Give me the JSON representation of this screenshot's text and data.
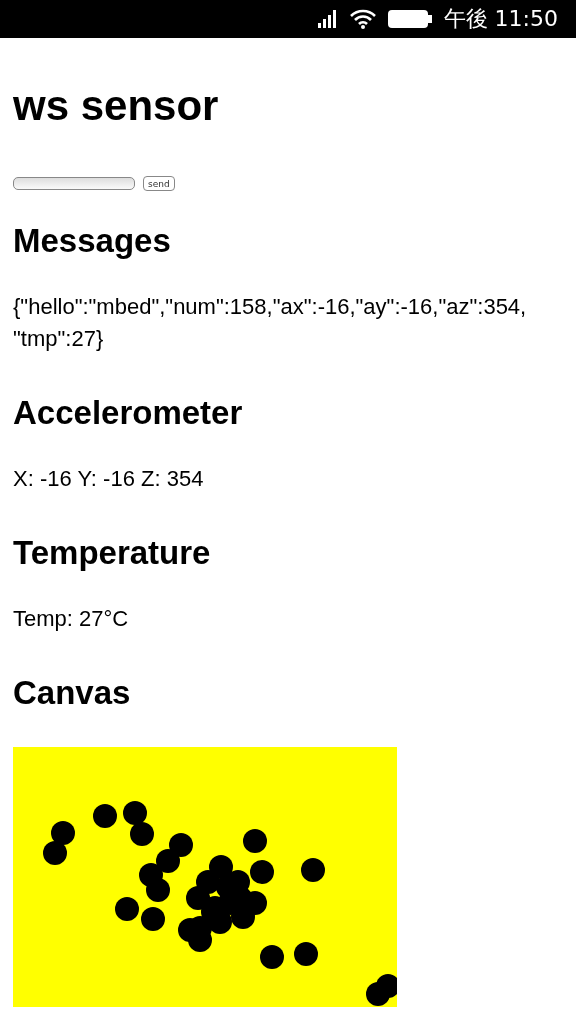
{
  "status_bar": {
    "time": "午後 11:50"
  },
  "title": "ws sensor",
  "form": {
    "button": "send"
  },
  "sections": [
    {
      "kind": "text",
      "heading": "Messages",
      "text": "{\"hello\":\"mbed\",\"num\":158,\"ax\":-16,\"ay\":-16,\"az\":354,\"tmp\":27}"
    },
    {
      "kind": "text",
      "heading": "Accelerometer",
      "text": "X: -16 Y: -16 Z: 354"
    },
    {
      "kind": "text",
      "heading": "Temperature",
      "text": "Temp: 27°C"
    },
    {
      "kind": "canvas",
      "heading": "Canvas"
    }
  ]
}
